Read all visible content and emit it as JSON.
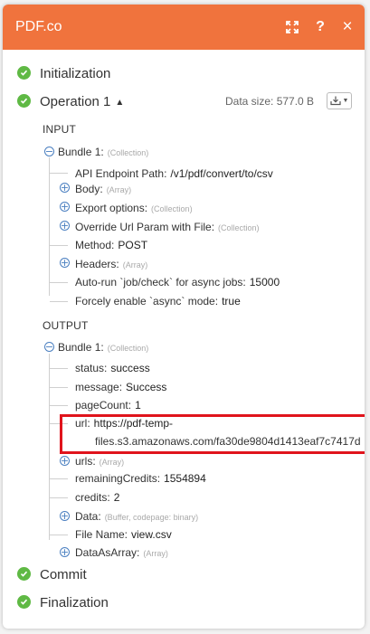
{
  "header": {
    "title": "PDF.co",
    "accent": "#f0733d",
    "icons": [
      "expand-icon",
      "help-icon",
      "close-icon"
    ],
    "help_label": "?",
    "close_label": "×"
  },
  "steps": {
    "initialization": "Initialization",
    "operation": "Operation 1",
    "commit": "Commit",
    "finalization": "Finalization"
  },
  "operation": {
    "caret": "▲",
    "data_size": "Data size: 577.0 B"
  },
  "input": {
    "section_label": "INPUT",
    "bundle_label": "Bundle 1:",
    "bundle_type": "(Collection)",
    "items": {
      "api_endpoint": {
        "key": "API Endpoint Path:",
        "value": "/v1/pdf/convert/to/csv"
      },
      "body": {
        "key": "Body:",
        "type": "(Array)"
      },
      "export_options": {
        "key": "Export options:",
        "type": "(Collection)"
      },
      "override_url": {
        "key": "Override Url Param with File:",
        "type": "(Collection)"
      },
      "method": {
        "key": "Method:",
        "value": "POST"
      },
      "headers": {
        "key": "Headers:",
        "type": "(Array)"
      },
      "auto_run": {
        "key": "Auto-run `job/check` for async jobs:",
        "value": "15000"
      },
      "force_async": {
        "key": "Forcely enable `async` mode:",
        "value": "true"
      }
    }
  },
  "output": {
    "section_label": "OUTPUT",
    "bundle_label": "Bundle 1:",
    "bundle_type": "(Collection)",
    "items": {
      "status": {
        "key": "status:",
        "value": "success"
      },
      "message": {
        "key": "message:",
        "value": "Success"
      },
      "page_count": {
        "key": "pageCount:",
        "value": "1"
      },
      "url": {
        "key": "url:",
        "value_line1": "https://pdf-temp-",
        "value_line2": "files.s3.amazonaws.com/fa30de9804d1413eaf7c7417d"
      },
      "urls": {
        "key": "urls:",
        "type": "(Array)"
      },
      "remaining_credits": {
        "key": "remainingCredits:",
        "value": "1554894"
      },
      "credits": {
        "key": "credits:",
        "value": "2"
      },
      "data": {
        "key": "Data:",
        "type": "(Buffer, codepage: binary)"
      },
      "file_name": {
        "key": "File Name:",
        "value": "view.csv"
      },
      "data_as_array": {
        "key": "DataAsArray:",
        "type": "(Array)"
      }
    }
  },
  "colors": {
    "check_green": "#5fb944",
    "highlight_red": "#e0141c",
    "toggle_blue": "#4a7fc0"
  }
}
